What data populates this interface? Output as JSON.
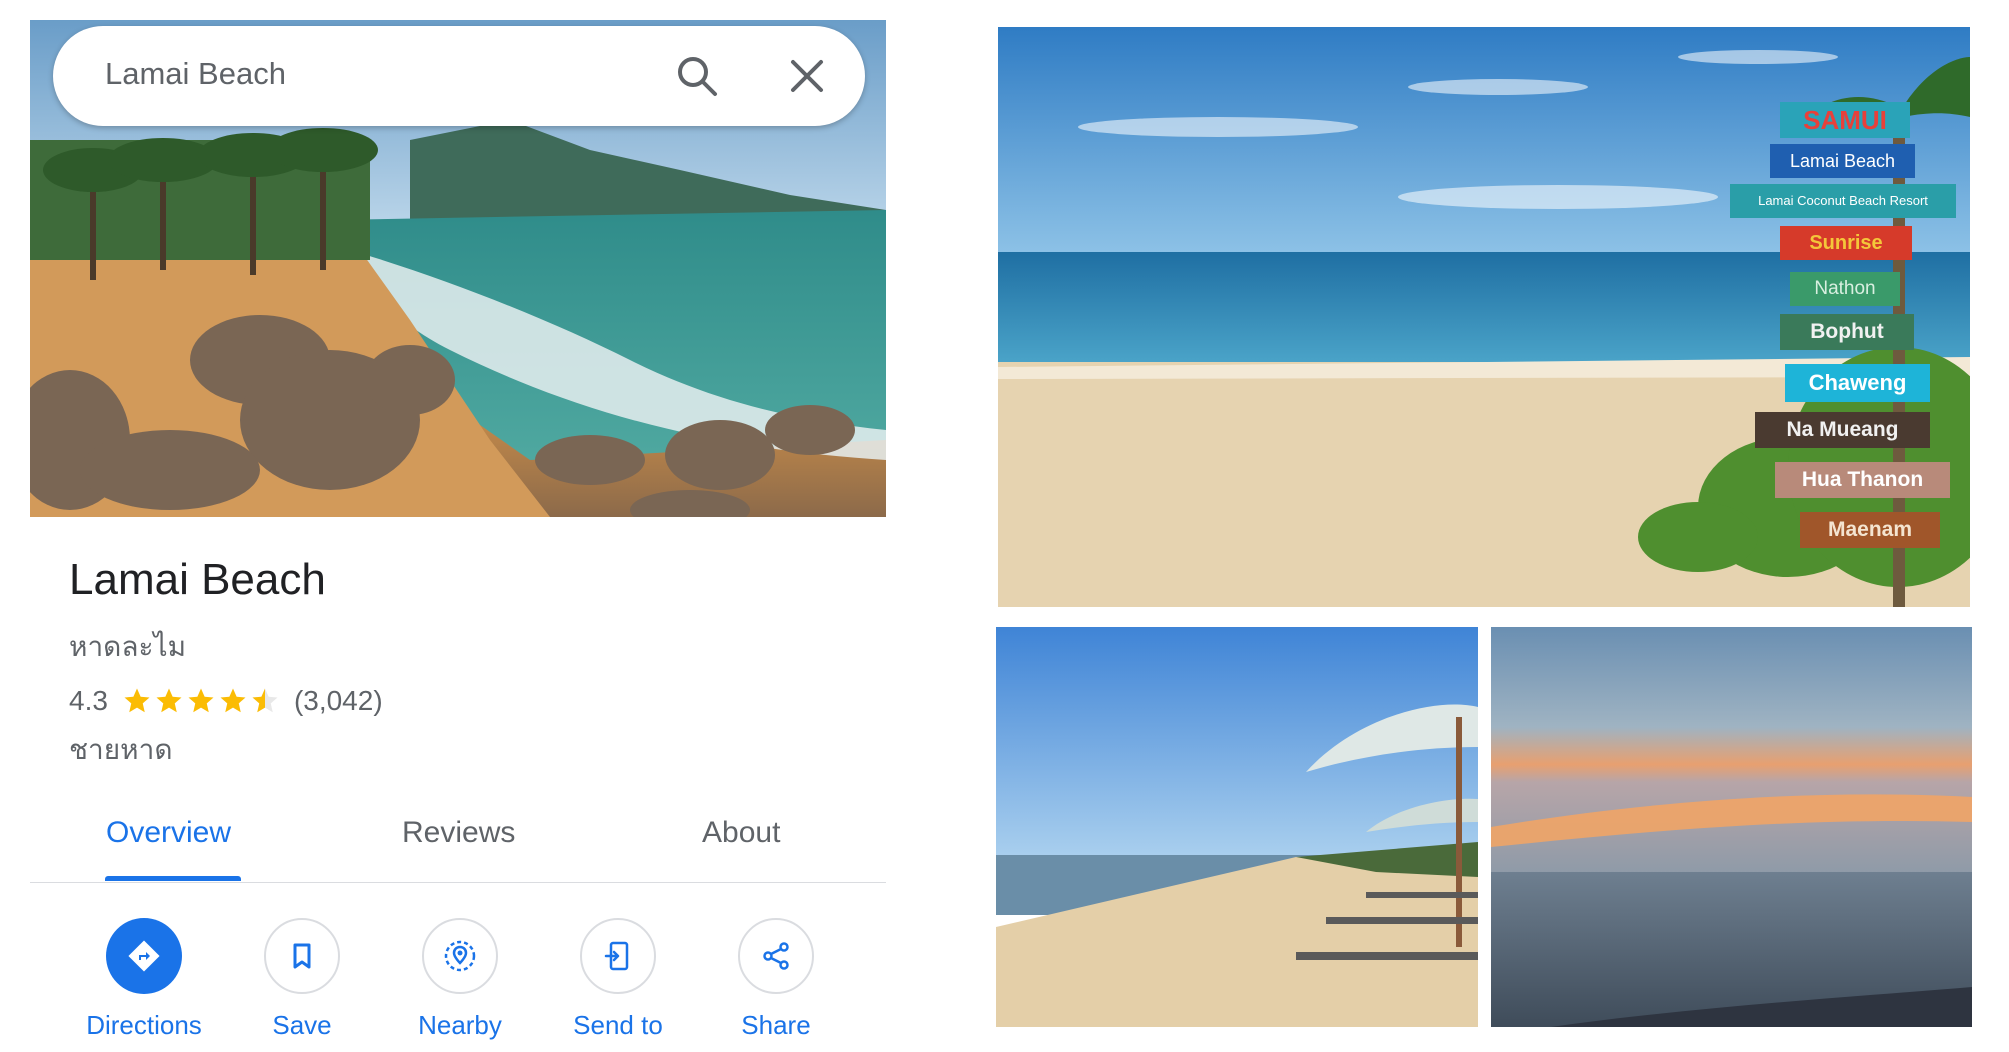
{
  "search": {
    "query": "Lamai Beach"
  },
  "place": {
    "title": "Lamai Beach",
    "local_name": "หาดละไม",
    "rating": "4.3",
    "stars_value": 4.3,
    "review_count": "(3,042)",
    "category": "ชายหาด"
  },
  "tabs": [
    {
      "label": "Overview",
      "active": true
    },
    {
      "label": "Reviews",
      "active": false
    },
    {
      "label": "About",
      "active": false
    }
  ],
  "actions": [
    {
      "label": "Directions",
      "icon": "directions-icon"
    },
    {
      "label": "Save",
      "icon": "bookmark-icon"
    },
    {
      "label": "Nearby",
      "icon": "nearby-icon"
    },
    {
      "label": "Send to",
      "icon": "send-to-device-icon"
    },
    {
      "label": "Share",
      "icon": "share-icon"
    }
  ],
  "signpost": [
    "SAMUI",
    "Lamai Beach",
    "Lamai Coconut Beach Resort",
    "Sunrise",
    "Nathon",
    "Bophut",
    "Chaweng",
    "Na Mueang",
    "Hua Thanon",
    "Maenam"
  ],
  "colors": {
    "accent": "#1a73e8",
    "star": "#fbbc04",
    "text_primary": "#202124",
    "text_secondary": "#5f6368"
  }
}
